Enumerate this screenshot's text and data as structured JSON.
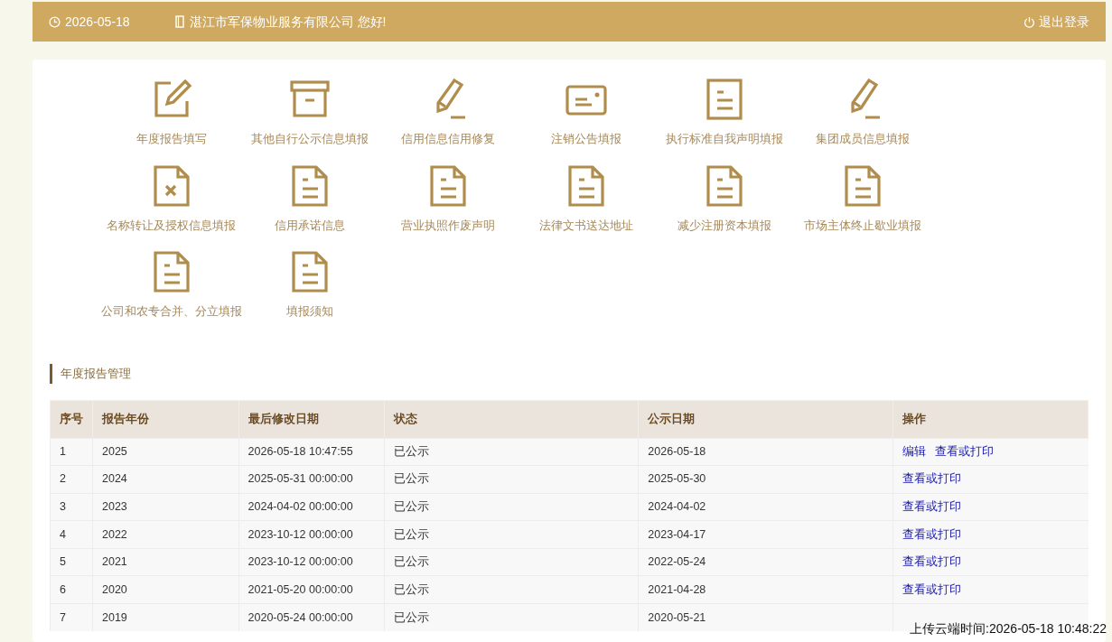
{
  "header": {
    "date": "2026-05-18",
    "greeting": "湛江市军保物业服务有限公司 您好!",
    "logout": "退出登录"
  },
  "tiles": [
    {
      "kind": "edit",
      "label": "年度报告填写"
    },
    {
      "kind": "archive",
      "label": "其他自行公示信息填报"
    },
    {
      "kind": "pencil",
      "label": "信用信息信用修复"
    },
    {
      "kind": "card",
      "label": "注销公告填报"
    },
    {
      "kind": "doc",
      "label": "执行标准自我声明填报"
    },
    {
      "kind": "pencil",
      "label": "集团成员信息填报"
    },
    {
      "kind": "docx",
      "label": "名称转让及授权信息填报"
    },
    {
      "kind": "page",
      "label": "信用承诺信息"
    },
    {
      "kind": "page",
      "label": "营业执照作废声明"
    },
    {
      "kind": "page",
      "label": "法律文书送达地址"
    },
    {
      "kind": "page",
      "label": "减少注册资本填报"
    },
    {
      "kind": "page",
      "label": "市场主体终止歇业填报"
    },
    {
      "kind": "page",
      "label": "公司和农专合并、分立填报"
    },
    {
      "kind": "page",
      "label": "填报须知"
    }
  ],
  "section_title": "年度报告管理",
  "table": {
    "columns": [
      "序号",
      "报告年份",
      "最后修改日期",
      "状态",
      "公示日期",
      "操作"
    ],
    "rows": [
      {
        "cells": [
          "1",
          "2025",
          "2026-05-18 10:47:55",
          "已公示",
          "2026-05-18"
        ],
        "actions": [
          "编辑",
          "查看或打印"
        ]
      },
      {
        "cells": [
          "2",
          "2024",
          "2025-05-31 00:00:00",
          "已公示",
          "2025-05-30"
        ],
        "actions": [
          "查看或打印"
        ]
      },
      {
        "cells": [
          "3",
          "2023",
          "2024-04-02 00:00:00",
          "已公示",
          "2024-04-02"
        ],
        "actions": [
          "查看或打印"
        ]
      },
      {
        "cells": [
          "4",
          "2022",
          "2023-10-12 00:00:00",
          "已公示",
          "2023-04-17"
        ],
        "actions": [
          "查看或打印"
        ]
      },
      {
        "cells": [
          "5",
          "2021",
          "2023-10-12 00:00:00",
          "已公示",
          "2022-05-24"
        ],
        "actions": [
          "查看或打印"
        ]
      },
      {
        "cells": [
          "6",
          "2020",
          "2021-05-20 00:00:00",
          "已公示",
          "2021-04-28"
        ],
        "actions": [
          "查看或打印"
        ]
      },
      {
        "cells": [
          "7",
          "2019",
          "2020-05-24 00:00:00",
          "已公示",
          "2020-05-21"
        ],
        "actions": []
      }
    ]
  },
  "upload_time": "上传云端时间:2026-05-18 10:48:22"
}
